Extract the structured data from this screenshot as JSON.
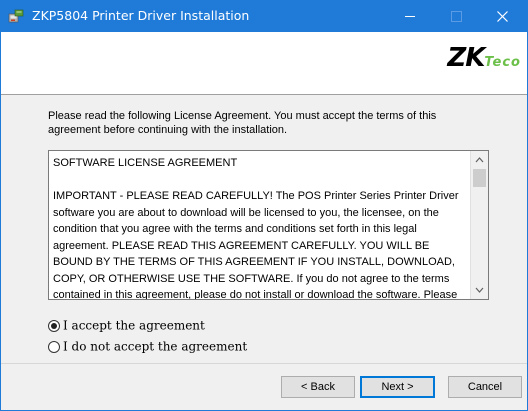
{
  "window": {
    "title": "ZKP5804 Printer Driver Installation",
    "accent_color": "#1f7ad8",
    "icon": "installer-icon"
  },
  "header": {
    "logo_primary": "ZK",
    "logo_secondary": "Teco",
    "logo_accent_color": "#6cc04a"
  },
  "intro_text": "Please read the following License Agreement. You must accept the terms of this agreement before continuing with the installation.",
  "license": {
    "heading": "SOFTWARE LICENSE AGREEMENT",
    "body": "IMPORTANT - PLEASE READ CAREFULLY! The POS Printer Series Printer Driver software you are about to download will be licensed to you, the licensee, on the condition that you agree with the terms and conditions set forth in this legal agreement. PLEASE READ THIS AGREEMENT CAREFULLY. YOU WILL BE BOUND BY THE TERMS OF THIS AGREEMENT IF YOU INSTALL, DOWNLOAD, COPY, OR OTHERWISE USE THE SOFTWARE. If you do not agree to the terms contained in this agreement, please do not install or download the software. Please read"
  },
  "options": {
    "accept_label": "I accept the agreement",
    "decline_label": "I do not accept the agreement",
    "selected": "accept"
  },
  "buttons": {
    "back": "< Back",
    "next": "Next >",
    "cancel": "Cancel"
  }
}
